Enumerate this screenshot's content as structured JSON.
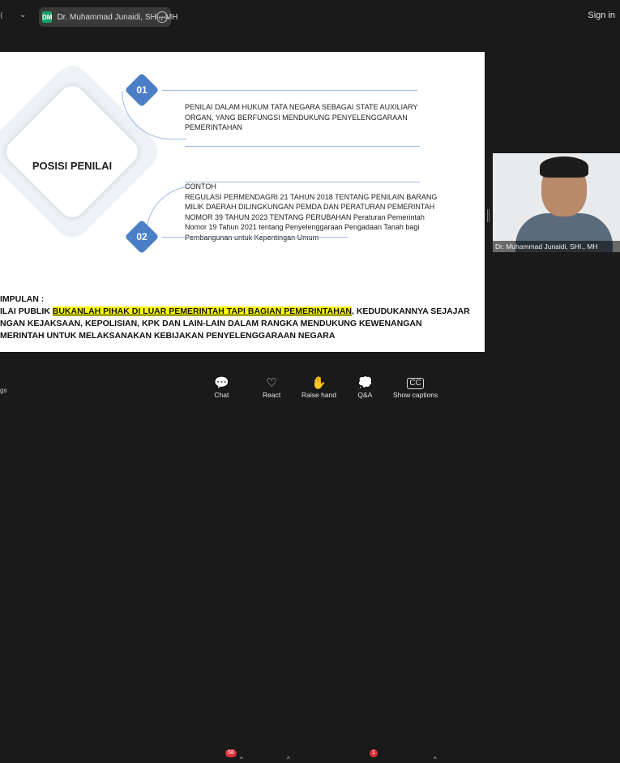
{
  "topbar": {
    "presenter_initials": "DM",
    "presenter_name": "Dr. Muhammad Junaidi, SHI., MH",
    "signin_label": "Sign in"
  },
  "slide": {
    "center_title": "POSISI PENILAI",
    "item1": {
      "number": "01",
      "lines": [
        "PENILAI DALAM HUKUM TATA NEGARA SEBAGAI STATE AUXILIARY",
        "ORGAN, YANG BERFUNGSI MENDUKUNG PENYELENGGARAAN",
        "PEMERINTAHAN"
      ]
    },
    "item2": {
      "number": "02",
      "lines": [
        "CONTOH",
        "REGULASI PERMENDAGRI 21 TAHUN 2018 TENTANG PENILAIN BARANG",
        "MILIK DAERAH DILINGKUNGAN PEMDA DAN PERATURAN PEMERINTAH",
        "NOMOR 39 TAHUN 2023  TENTANG PERUBAHAN Peraturan Pemerintah",
        "Nomor 19 Tahun 2021 tentang Penyelenggaraan Pengadaan Tanah bagi",
        "Pembangunan untuk Kepentingan Umum"
      ]
    },
    "conclusion": {
      "heading": "IMPULAN :",
      "line1_prefix": "ILAI PUBLIK ",
      "line1_highlight": "BUKANLAH PIHAK DI LUAR PEMERINTAH TAPI BAGIAN PEMERINTAHAN",
      "line1_suffix": ", KEDUDUKANNYA SEJAJAR",
      "line2": "NGAN KEJAKSAAN, KEPOLISIAN, KPK DAN LAIN-LAIN DALAM RANGKA MENDUKUNG KEWENANGAN",
      "line3": "MERINTAH UNTUK MELAKSANAKAN KEBIJAKAN PENYELENGGARAAN NEGARA"
    }
  },
  "video": {
    "participant_name": "Dr. Muhammad Junaidi, SHI., MH"
  },
  "toolbar": {
    "left_fragment": "gs",
    "chat": {
      "label": "Chat",
      "badge": "58"
    },
    "react": {
      "label": "React"
    },
    "raise_hand": {
      "label": "Raise hand"
    },
    "qa": {
      "label": "Q&A",
      "badge": "1"
    },
    "captions": {
      "label": "Show captions"
    }
  },
  "colors": {
    "accent_blue": "#4a7fc7",
    "highlight": "#ffff00",
    "badge_red": "#e0313b"
  },
  "icons": [
    "chevron-down-icon",
    "more-icon",
    "chat-icon",
    "heart-icon",
    "hand-icon",
    "qa-icon",
    "cc-icon",
    "caret-up-icon"
  ]
}
